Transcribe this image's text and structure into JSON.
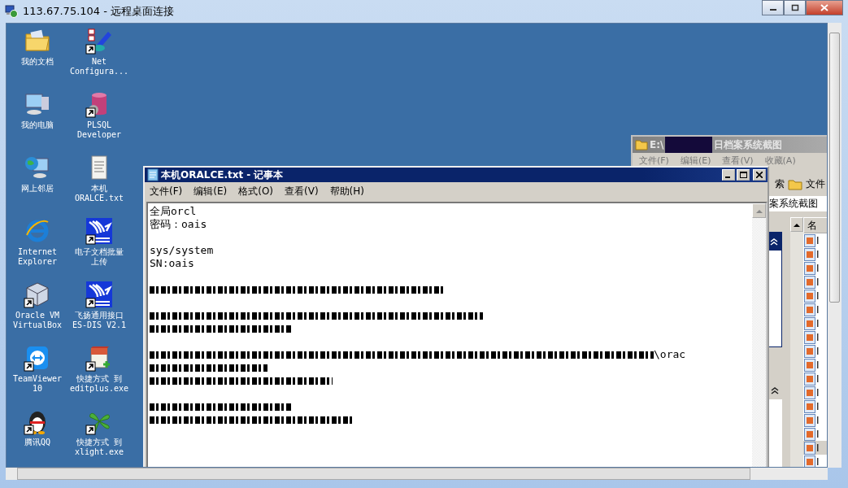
{
  "window": {
    "title": "113.67.75.104 - 远程桌面连接"
  },
  "desktop_icons": [
    {
      "label": [
        "我的文档"
      ],
      "shortcut": false
    },
    {
      "label": [
        "Net",
        "Configura..."
      ],
      "shortcut": true
    },
    {
      "label": [
        "我的电脑"
      ],
      "shortcut": false
    },
    {
      "label": [
        "PLSQL",
        "Developer"
      ],
      "shortcut": true
    },
    {
      "label": [
        "网上邻居"
      ],
      "shortcut": false
    },
    {
      "label": [
        "本机",
        "ORALCE.txt"
      ],
      "shortcut": false
    },
    {
      "label": [
        "Internet",
        "Explorer"
      ],
      "shortcut": false
    },
    {
      "label": [
        "电子文档批量",
        "上传"
      ],
      "shortcut": true
    },
    {
      "label": [
        "Oracle VM",
        "VirtualBox"
      ],
      "shortcut": true
    },
    {
      "label": [
        "飞扬通用接口",
        "ES-DIS V2.1"
      ],
      "shortcut": true
    },
    {
      "label": [
        "TeamViewer",
        "10"
      ],
      "shortcut": true
    },
    {
      "label": [
        "快捷方式 到",
        "editplus.exe"
      ],
      "shortcut": true
    },
    {
      "label": [
        "腾讯QQ"
      ],
      "shortcut": true
    },
    {
      "label": [
        "快捷方式 到",
        "xlight.exe"
      ],
      "shortcut": true
    }
  ],
  "explorer": {
    "title_start": "E:\\",
    "title_end": "日档案系统截图",
    "menu": [
      "文件(F)",
      "编辑(E)",
      "查看(V)",
      "收藏(A)"
    ],
    "toolbar": [
      "索",
      "文件"
    ],
    "address": "案系统截图",
    "column": "名",
    "files": [
      {
        "name": "I",
        "selected": false
      },
      {
        "name": "I",
        "selected": false
      },
      {
        "name": "I",
        "selected": false
      },
      {
        "name": "I",
        "selected": false
      },
      {
        "name": "I",
        "selected": false
      },
      {
        "name": "I",
        "selected": false
      },
      {
        "name": "I",
        "selected": false
      },
      {
        "name": "I",
        "selected": false
      },
      {
        "name": "I",
        "selected": false
      },
      {
        "name": "I",
        "selected": false
      },
      {
        "name": "I",
        "selected": false
      },
      {
        "name": "I",
        "selected": false
      },
      {
        "name": "I",
        "selected": false
      },
      {
        "name": "I",
        "selected": false
      },
      {
        "name": "I",
        "selected": false
      },
      {
        "name": "I",
        "selected": true
      },
      {
        "name": "I",
        "selected": false
      }
    ]
  },
  "notepad": {
    "title": "本机ORALCE.txt - 记事本",
    "menu": [
      "文件(F)",
      "编辑(E)",
      "格式(O)",
      "查看(V)",
      "帮助(H)"
    ],
    "lines": [
      {
        "kind": "text",
        "text": "全局orcl"
      },
      {
        "kind": "text",
        "text": "密码：oais"
      },
      {
        "kind": "blank"
      },
      {
        "kind": "text",
        "text": "sys/system"
      },
      {
        "kind": "text",
        "text": "SN:oais"
      },
      {
        "kind": "blank"
      },
      {
        "kind": "redacted"
      },
      {
        "kind": "blank"
      },
      {
        "kind": "redacted"
      },
      {
        "kind": "redacted"
      },
      {
        "kind": "blank"
      },
      {
        "kind": "redacted",
        "tail": "\\orac"
      },
      {
        "kind": "redacted"
      },
      {
        "kind": "redacted"
      },
      {
        "kind": "blank"
      },
      {
        "kind": "redacted"
      },
      {
        "kind": "redacted"
      }
    ]
  }
}
